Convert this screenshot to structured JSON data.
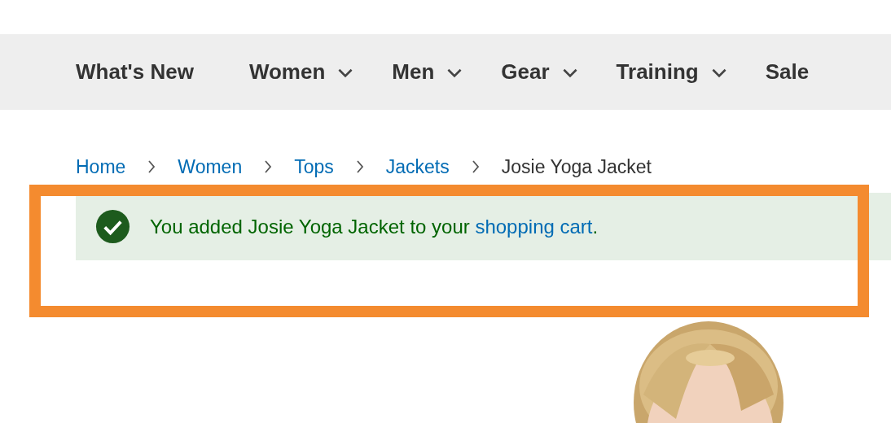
{
  "nav": {
    "items": [
      {
        "label": "What's New",
        "dropdown": false
      },
      {
        "label": "Women",
        "dropdown": true
      },
      {
        "label": "Men",
        "dropdown": true
      },
      {
        "label": "Gear",
        "dropdown": true
      },
      {
        "label": "Training",
        "dropdown": true
      },
      {
        "label": "Sale",
        "dropdown": false
      }
    ]
  },
  "breadcrumbs": [
    {
      "label": "Home",
      "link": true
    },
    {
      "label": "Women",
      "link": true
    },
    {
      "label": "Tops",
      "link": true
    },
    {
      "label": "Jackets",
      "link": true
    },
    {
      "label": "Josie Yoga Jacket",
      "link": false
    }
  ],
  "message": {
    "kind": "success",
    "text_before": "You added Josie Yoga Jacket to your ",
    "link": "shopping cart",
    "text_after": "."
  },
  "highlight": {
    "on": true
  }
}
